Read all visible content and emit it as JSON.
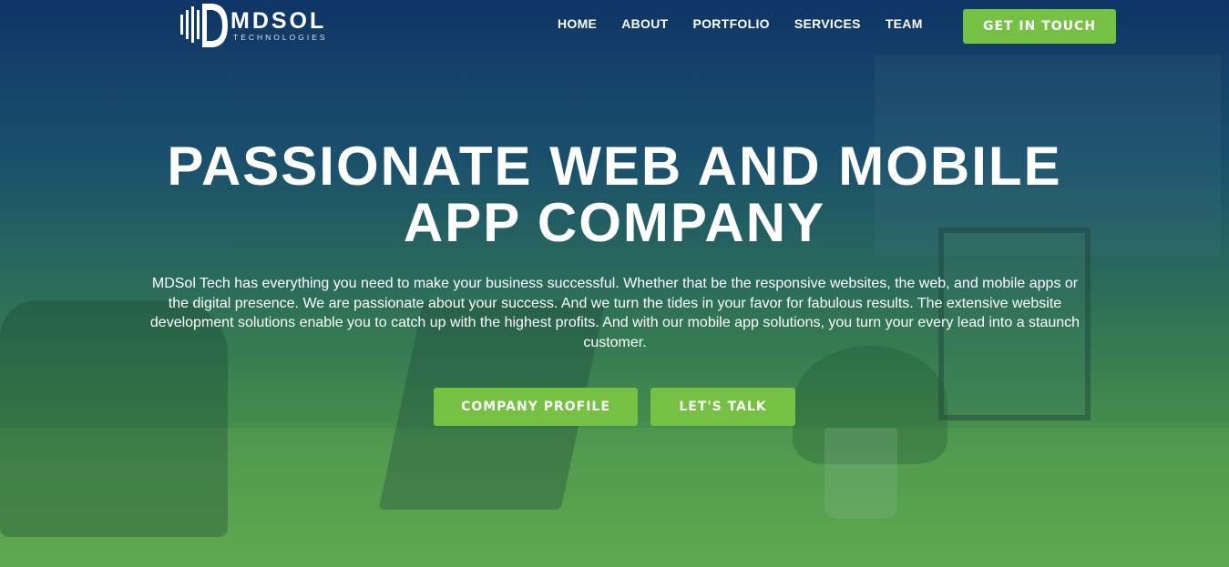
{
  "logo": {
    "name": "MDSOL",
    "tagline": "TECHNOLOGIES"
  },
  "nav": {
    "items": [
      "HOME",
      "ABOUT",
      "PORTFOLIO",
      "SERVICES",
      "TEAM"
    ]
  },
  "header": {
    "cta_label": "GET IN TOUCH"
  },
  "hero": {
    "headline_line1": "PASSIONATE WEB AND MOBILE",
    "headline_line2": "APP COMPANY",
    "description": "MDSol Tech has everything you need to make your business successful. Whether that be the responsive websites, the web, and mobile apps or the digital presence. We are passionate about your success. And we turn the tides in your favor for fabulous results. The extensive website development solutions enable you to catch up with the highest profits. And with our mobile app solutions, you turn your every lead into a staunch customer.",
    "primary_button": "COMPANY PROFILE",
    "secondary_button": "LET'S TALK"
  },
  "colors": {
    "accent_green": "#76c043",
    "overlay_top": "#0f3566",
    "overlay_bottom": "#5aa448"
  },
  "icons": {
    "logo_mark": "mdsol-logo-icon"
  }
}
